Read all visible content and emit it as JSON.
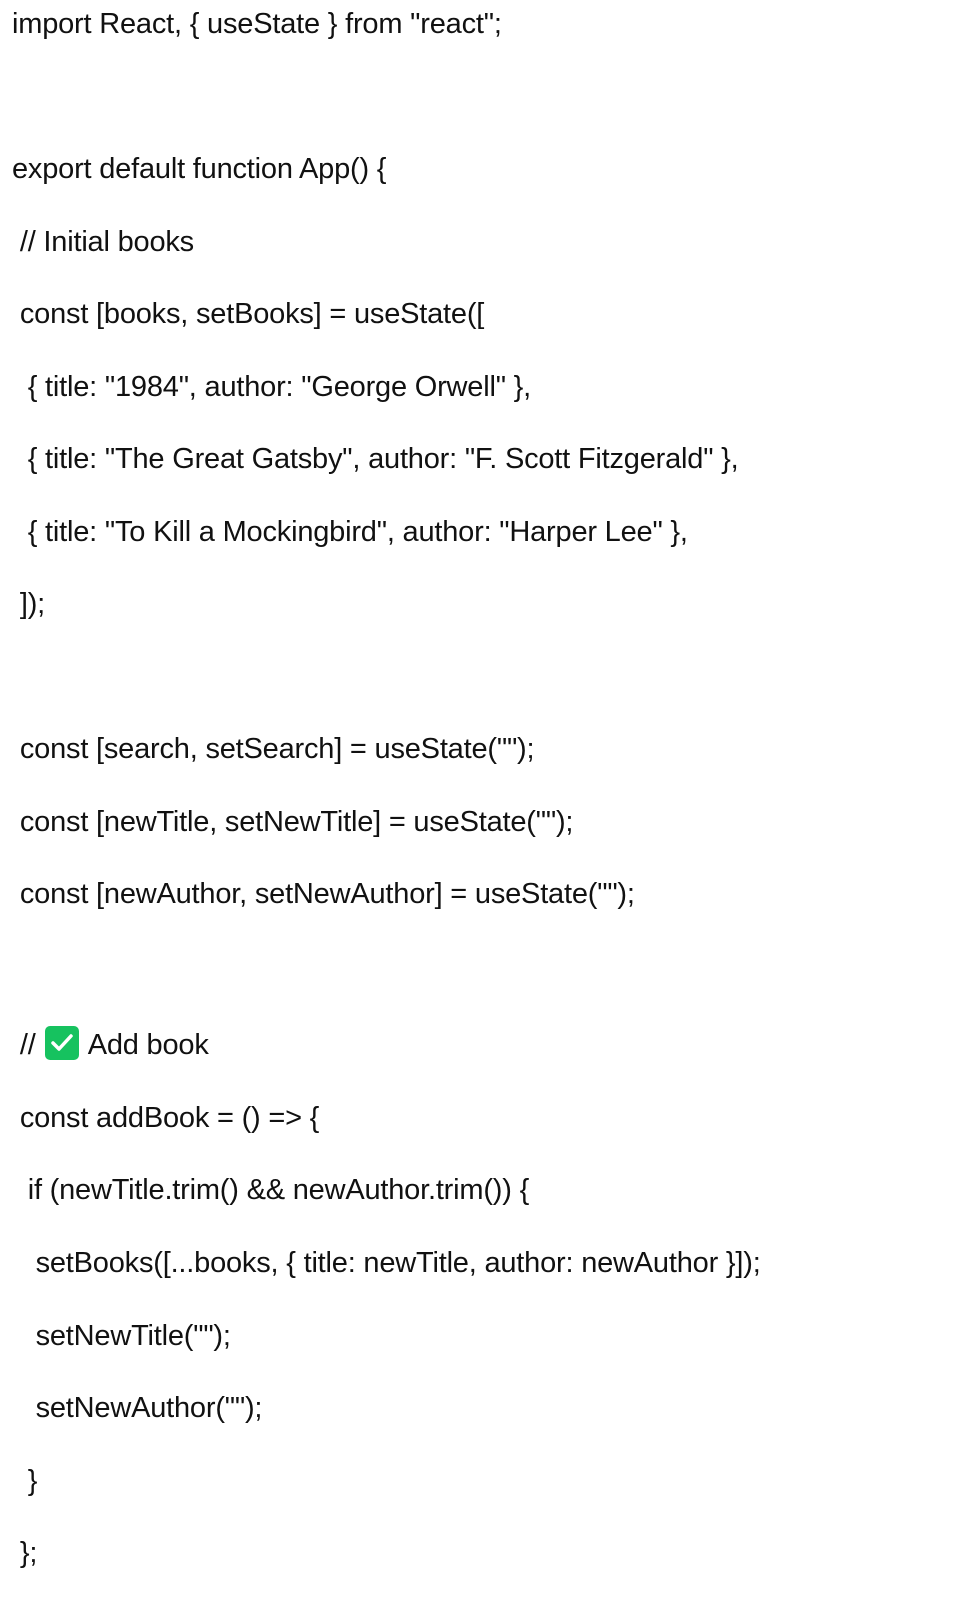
{
  "code": {
    "line_01": "import React, { useState } from \"react\";",
    "line_02": "export default function App() {",
    "line_03": " // Initial books",
    "line_04": " const [books, setBooks] = useState([",
    "line_05": "  { title: \"1984\", author: \"George Orwell\" },",
    "line_06": "  { title: \"The Great Gatsby\", author: \"F. Scott Fitzgerald\" },",
    "line_07": "  { title: \"To Kill a Mockingbird\", author: \"Harper Lee\" },",
    "line_08": " ]);",
    "line_09": " const [search, setSearch] = useState(\"\");",
    "line_10": " const [newTitle, setNewTitle] = useState(\"\");",
    "line_11": " const [newAuthor, setNewAuthor] = useState(\"\");",
    "line_12_prefix": " // ",
    "line_12_text": " Add book",
    "line_13": " const addBook = () => {",
    "line_14": "  if (newTitle.trim() && newAuthor.trim()) {",
    "line_15": "   setBooks([...books, { title: newTitle, author: newAuthor }]);",
    "line_16": "   setNewTitle(\"\");",
    "line_17": "   setNewAuthor(\"\");",
    "line_18": "  }",
    "line_19": " };"
  },
  "icons": {
    "check": "check-mark-button-icon",
    "check_color": "#16c25f"
  }
}
